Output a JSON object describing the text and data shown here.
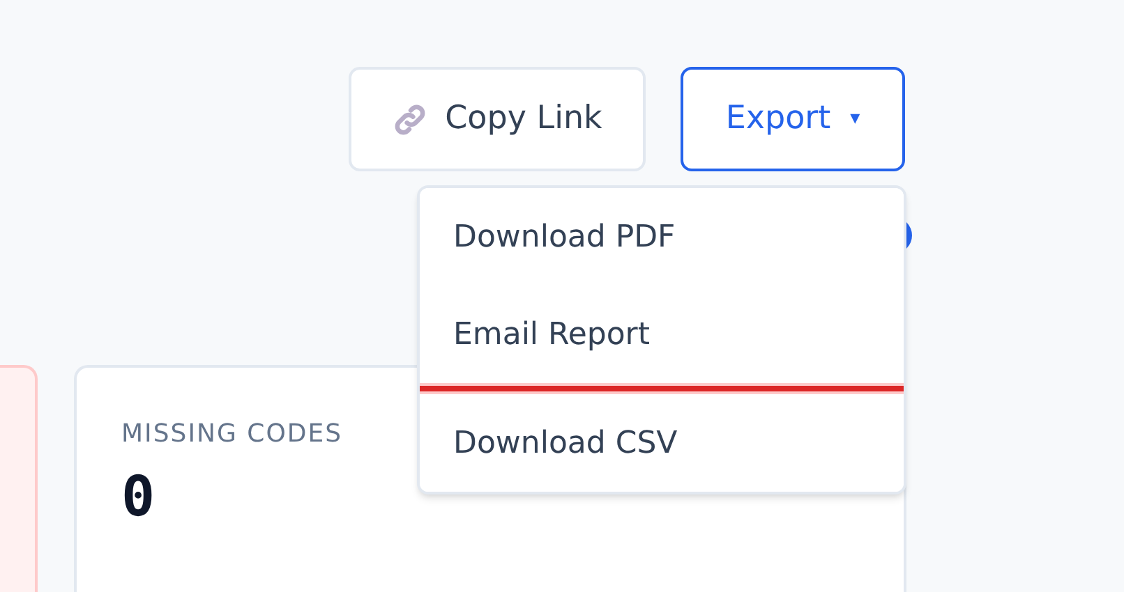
{
  "toolbar": {
    "copy_button": {
      "label": "Copy Link"
    },
    "export_button": {
      "label": "Export",
      "caret": "▾",
      "expanded": true
    }
  },
  "export_menu": {
    "items": [
      {
        "label": "Download PDF"
      },
      {
        "label": "Email Report"
      },
      {
        "label": "Download CSV"
      }
    ]
  },
  "cards": [
    {
      "kind": "alert"
    },
    {
      "kind": "stat",
      "label": "MISSING CODES",
      "value": "0"
    }
  ]
}
